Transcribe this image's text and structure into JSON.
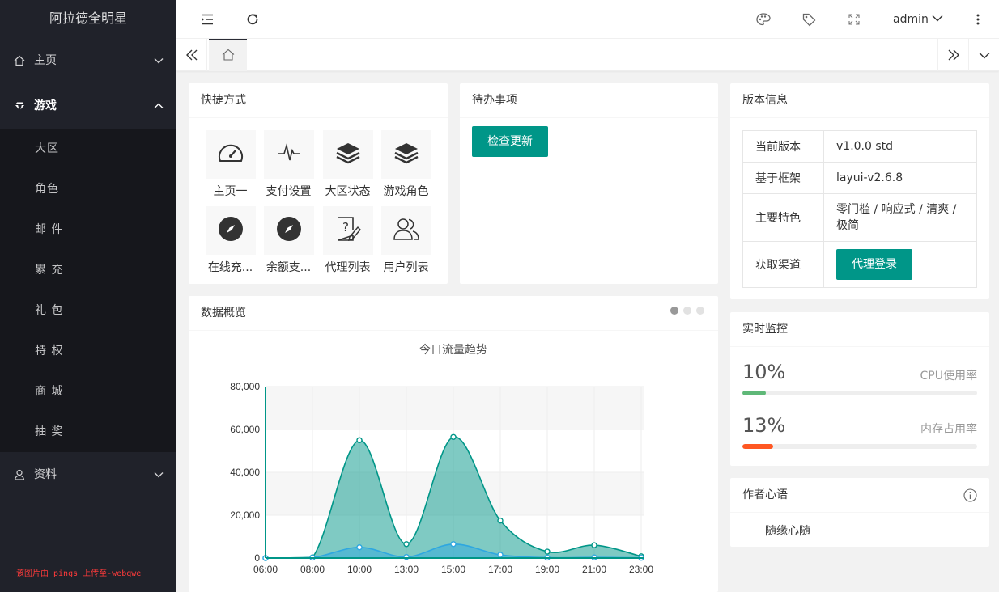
{
  "app": {
    "title": "阿拉德全明星"
  },
  "sidebar": {
    "items": [
      {
        "label": "主页"
      },
      {
        "label": "游戏",
        "children": [
          "大区",
          "角色",
          "邮 件",
          "累 充",
          "礼 包",
          "特 权",
          "商 城",
          "抽 奖"
        ]
      },
      {
        "label": "资料"
      }
    ],
    "watermark": "该图片由 pings 上传至-webqwe"
  },
  "header": {
    "user": "admin"
  },
  "shortcuts": {
    "title": "快捷方式",
    "items": [
      {
        "label": "主页一",
        "icon": "gauge-icon"
      },
      {
        "label": "支付设置",
        "icon": "pulse-icon"
      },
      {
        "label": "大区状态",
        "icon": "layers-icon"
      },
      {
        "label": "游戏角色",
        "icon": "layers-icon"
      },
      {
        "label": "在线充...",
        "icon": "compass-icon"
      },
      {
        "label": "余额支...",
        "icon": "compass-icon"
      },
      {
        "label": "代理列表",
        "icon": "help-doc-icon"
      },
      {
        "label": "用户列表",
        "icon": "users-icon"
      }
    ]
  },
  "todo": {
    "title": "待办事项",
    "button": "检查更新"
  },
  "version": {
    "title": "版本信息",
    "rows": [
      {
        "key": "当前版本",
        "value": "v1.0.0 std"
      },
      {
        "key": "基于框架",
        "value": "layui-v2.6.8"
      },
      {
        "key": "主要特色",
        "value": "零门槛 / 响应式 / 清爽 / 极简"
      },
      {
        "key": "获取渠道",
        "button": "代理登录"
      }
    ]
  },
  "overview": {
    "title": "数据概览"
  },
  "monitor": {
    "title": "实时监控",
    "cpu": {
      "value": "10%",
      "label": "CPU使用率",
      "fraction": 0.1,
      "color": "#5fb878"
    },
    "mem": {
      "value": "13%",
      "label": "内存占用率",
      "fraction": 0.13,
      "color": "#ff5722"
    }
  },
  "author": {
    "title": "作者心语",
    "text": "随缘心随"
  },
  "chart_data": {
    "type": "area",
    "title": "今日流量趋势",
    "x": [
      "06:00",
      "08:00",
      "10:00",
      "13:00",
      "15:00",
      "17:00",
      "19:00",
      "21:00",
      "23:00"
    ],
    "ylim": [
      0,
      80000
    ],
    "yticks": [
      "0",
      "20,000",
      "40,000",
      "60,000",
      "80,000"
    ],
    "grid": true,
    "series": [
      {
        "values": [
          0,
          300,
          55000,
          6500,
          56500,
          17500,
          3000,
          6000,
          800
        ],
        "color": "#009688"
      },
      {
        "values": [
          0,
          200,
          5000,
          500,
          6500,
          1500,
          200,
          300,
          100
        ],
        "color": "#2ea7e0"
      }
    ]
  }
}
